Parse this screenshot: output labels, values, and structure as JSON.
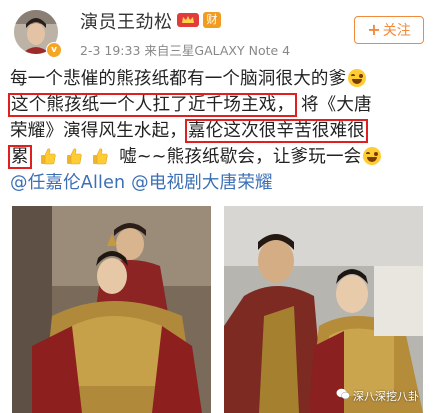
{
  "header": {
    "username": "演员王劲松",
    "cai_badge": "财",
    "meta": "2-3 19:33  来自三星GALAXY Note 4",
    "follow_label": "关注",
    "verified_badge": "v"
  },
  "post": {
    "line1": "每一个悲催的熊孩纸都有一个脑洞很大的爹",
    "line2_highlight": "这个熊孩纸一个人扛了近千场主戏，",
    "line2_rest": " 将《大唐",
    "line3_start": "荣耀》演得风生水起，",
    "line3_highlight": "嘉伦这次很辛苦很难很",
    "line4_highlight": "累",
    "line4_rest": " 嘘~~熊孩纸歇会，让爹玩一会",
    "mention1": "@任嘉伦Allen",
    "mention2": "@电视剧大唐荣耀"
  },
  "watermark": "深八深挖八卦",
  "colors": {
    "highlight_border": "#e02020",
    "mention": "#3b6fb6",
    "follow": "#f28a3c",
    "vip_badge": "#e23b3b",
    "cai_badge": "#f29c1f"
  },
  "icons": {
    "vip": "vip-crown-icon",
    "laugh": "laughing-emoji-icon",
    "thumb": "thumbs-up-emoji-icon",
    "watermark": "wechat-logo-icon"
  }
}
